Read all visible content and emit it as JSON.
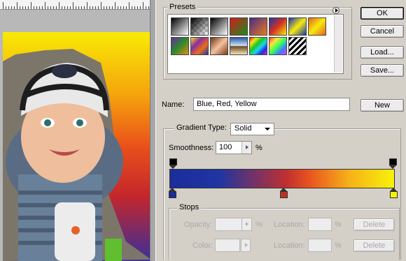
{
  "canvas": {
    "ruler_icon": "ruler",
    "image_icon": "photo-of-baby-on-gradient",
    "background_gradient_colors": [
      "#f8ea05",
      "#f5a20c",
      "#e9501a",
      "#c3262c",
      "#3a2f9a"
    ]
  },
  "dialog": {
    "presets": {
      "legend": "Presets",
      "menu_icon": "flyout-arrow-icon",
      "swatches": [
        {
          "name": "foreground-to-background",
          "css": "linear-gradient(135deg,#000 0%,#fff 100%)"
        },
        {
          "name": "foreground-to-transparent",
          "css": "linear-gradient(135deg,#000 0%,#888 50%,#fff 100%)"
        },
        {
          "name": "black-white",
          "css": "linear-gradient(135deg,#000 0%,#fff 100%)"
        },
        {
          "name": "red-green",
          "css": "linear-gradient(135deg,#d11d1d 0%,#1d8a1d 100%)"
        },
        {
          "name": "violet-orange",
          "css": "linear-gradient(135deg,#4b2a8a 0%,#e77b1b 100%)"
        },
        {
          "name": "blue-red-yellow",
          "css": "linear-gradient(135deg,#1d35a8 0%,#d63222 50%,#f6ea0d 100%)"
        },
        {
          "name": "blue-yellow-blue",
          "css": "linear-gradient(135deg,#1d35a8 0%,#f6ea0d 50%,#1d35a8 100%)"
        },
        {
          "name": "orange-yellow-orange",
          "css": "linear-gradient(135deg,#e9621b 0%,#f6ea0d 50%,#e9621b 100%)"
        },
        {
          "name": "violet-green-orange",
          "css": "linear-gradient(135deg,#6a2a9c 0%,#2c8c2a 50%,#e7891b 100%)"
        },
        {
          "name": "yellow-violet-orange-blue",
          "css": "linear-gradient(135deg,#f4e31b 0%,#8a2ea0 33%,#ea6c1c 66%,#1c3aa8 100%)"
        },
        {
          "name": "copper",
          "css": "linear-gradient(135deg,#6e3315 0%,#f4c2a0 50%,#7a3a18 100%)"
        },
        {
          "name": "chrome",
          "css": "linear-gradient(180deg,#2a5aa8 0%,#cfe3f8 48%,#6b4a1f 52%,#f4e2b8 100%)"
        },
        {
          "name": "spectrum",
          "css": "linear-gradient(135deg,#e51c1c 0%,#f4ea1b 20%,#1cc41c 40%,#1cd6e8 60%,#1c2ce5 80%,#d81ce5 100%)"
        },
        {
          "name": "transparent-rainbow",
          "css": "linear-gradient(135deg,#ff3a3a 0%,#ffe43a 25%,#3aff5a 50%,#3a7bff 75%,#e43aff 100%)"
        },
        {
          "name": "transparent-stripes",
          "css": "repeating-linear-gradient(135deg,#000 0px,#000 3px,#fff 3px,#fff 6px)"
        }
      ]
    },
    "buttons": {
      "ok": "OK",
      "cancel": "Cancel",
      "load": "Load...",
      "save": "Save...",
      "new": "New"
    },
    "name_label": "Name:",
    "name_value": "Blue, Red, Yellow",
    "gradient_type_legend": "Gradient Type:",
    "gradient_type_value": "Solid",
    "smoothness_label": "Smoothness:",
    "smoothness_value": "100",
    "smoothness_unit": "%",
    "gradient_bar_colors": [
      "#1b2d9a",
      "#c03030",
      "#f8f20a"
    ],
    "opacity_stops": [
      {
        "name": "opacity-stop-left",
        "color": "#000000"
      },
      {
        "name": "opacity-stop-right",
        "color": "#000000"
      }
    ],
    "color_stops": [
      {
        "name": "color-stop-blue",
        "color": "#1b2d9a"
      },
      {
        "name": "color-stop-red",
        "color": "#c03020"
      },
      {
        "name": "color-stop-yellow",
        "color": "#f8f20a"
      }
    ],
    "stops": {
      "legend": "Stops",
      "opacity_label": "Opacity:",
      "opacity_unit": "%",
      "opacity_location_label": "Location:",
      "opacity_location_unit": "%",
      "opacity_delete": "Delete",
      "color_label": "Color:",
      "color_location_label": "Location:",
      "color_location_unit": "%",
      "color_delete": "Delete"
    }
  }
}
